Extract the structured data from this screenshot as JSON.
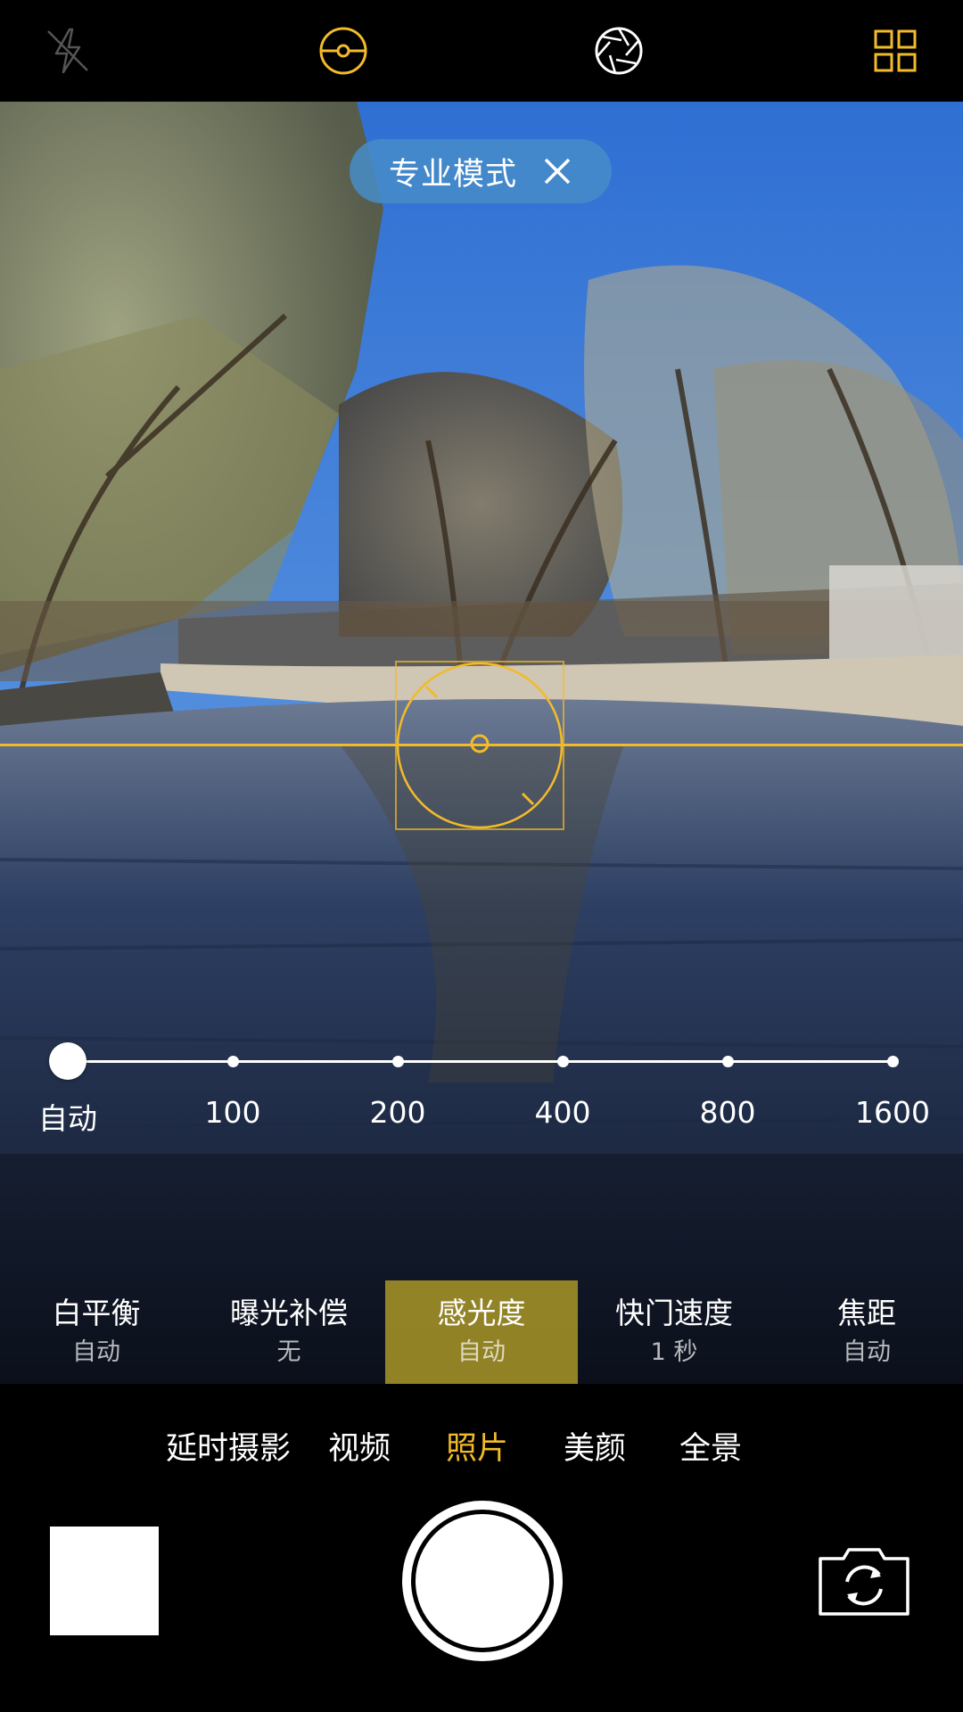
{
  "top_bar": {
    "icons": [
      "flash-off-icon",
      "level-icon",
      "aperture-icon",
      "grid-menu-icon"
    ],
    "accent_color": "#f3bb2a"
  },
  "mode_pill": {
    "label": "专业模式"
  },
  "iso_slider": {
    "selected": "自动",
    "stops": [
      "自动",
      "100",
      "200",
      "400",
      "800",
      "1600"
    ]
  },
  "params": [
    {
      "title": "白平衡",
      "value": "自动"
    },
    {
      "title": "曝光补偿",
      "value": "无"
    },
    {
      "title": "感光度",
      "value": "自动"
    },
    {
      "title": "快门速度",
      "value": "1 秒"
    },
    {
      "title": "焦距",
      "value": "自动"
    }
  ],
  "active_param": "感光度",
  "modes": [
    "延时摄影",
    "视频",
    "照片",
    "美颜",
    "全景"
  ],
  "active_mode": "照片",
  "colors": {
    "accent": "#f3bb2a",
    "active_param_bg": "#aa9628",
    "pill_bg": "#468cc8"
  }
}
